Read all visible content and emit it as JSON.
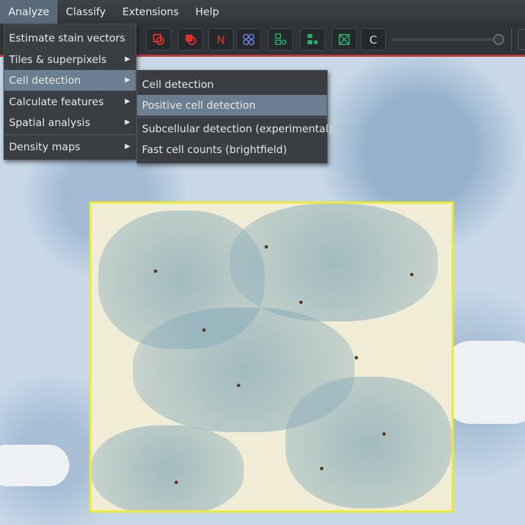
{
  "menubar": {
    "items": [
      "Analyze",
      "Classify",
      "Extensions",
      "Help"
    ]
  },
  "toolbar": {
    "tools": [
      {
        "icon": "red-annotation-select-icon",
        "color": "#e03030"
      },
      {
        "icon": "red-annotation-fill-icon",
        "color": "#e03030"
      },
      {
        "icon": "N",
        "color": "#e03030"
      },
      {
        "icon": "blue-cells-icon",
        "color": "#6a7ce0"
      },
      {
        "icon": "green-hierarchy-icon",
        "color": "#2aa86a"
      },
      {
        "icon": "green-detection-icon",
        "color": "#2aa86a"
      },
      {
        "icon": "green-grid-icon",
        "color": "#2aa86a"
      },
      {
        "icon": "C",
        "color": "#d8d8d8"
      }
    ],
    "opacity_slider_value": 1.0
  },
  "analyze_menu": {
    "items": [
      {
        "label": "Estimate stain vectors",
        "submenu": false
      },
      {
        "label": "Tiles & superpixels",
        "submenu": true
      },
      {
        "label": "Cell detection",
        "submenu": true
      },
      {
        "label": "Calculate features",
        "submenu": true
      },
      {
        "label": "Spatial analysis",
        "submenu": true
      },
      {
        "label": "Density maps",
        "submenu": true
      }
    ],
    "highlighted": "Cell detection"
  },
  "cell_detection_submenu": {
    "items": [
      "Cell detection",
      "Positive cell detection",
      "Subcellular detection (experimental)",
      "Fast cell counts (brightfield)"
    ],
    "highlighted": "Positive cell detection"
  },
  "colors": {
    "roi_border": "#ecec2a",
    "menu_background": "#3a3e42",
    "menu_highlight": "#6c7f91",
    "toolbar_accent": "#c23a3a"
  }
}
